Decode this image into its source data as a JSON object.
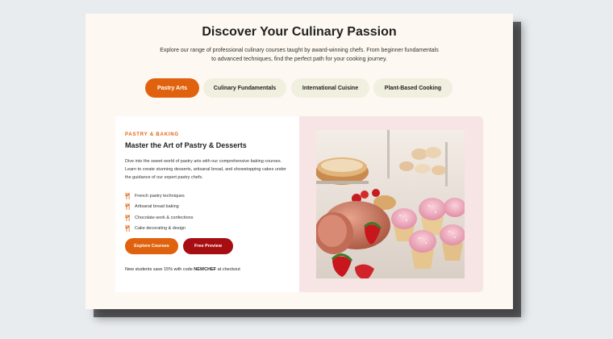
{
  "header": {
    "title": "Discover Your Culinary Passion",
    "subtitle_line1": "Explore our range of professional culinary courses taught by award-winning chefs. From beginner fundamentals",
    "subtitle_line2": "to advanced techniques, find the perfect path for your cooking journey."
  },
  "tabs": [
    {
      "label": "Pastry Arts",
      "active": true
    },
    {
      "label": "Culinary Fundamentals",
      "active": false
    },
    {
      "label": "International Cuisine",
      "active": false
    },
    {
      "label": "Plant-Based Cooking",
      "active": false
    }
  ],
  "course": {
    "eyebrow": "PASTRY & BAKING",
    "title": "Master the Art of Pastry & Desserts",
    "description": "Dive into the sweet world of pastry arts with our comprehensive baking courses. Learn to create stunning desserts, artisanal bread, and showstopping cakes under the guidance of our expert pastry chefs.",
    "features": [
      "French pastry techniques",
      "Artisanal bread baking",
      "Chocolate work & confections",
      "Cake decorating & design"
    ],
    "feature_icon": "utensils-icon",
    "explore_label": "Explore Courses",
    "preview_label": "Free Preview",
    "promo_prefix": "New students save 15% with code ",
    "promo_code": "NEWCHEF",
    "promo_suffix": " at checkout"
  },
  "colors": {
    "accent": "#e0620e",
    "secondary": "#a60e12",
    "card_background": "#fdf8f1",
    "tab_background": "#f1efdf",
    "image_panel_background": "#f7e4e4"
  }
}
